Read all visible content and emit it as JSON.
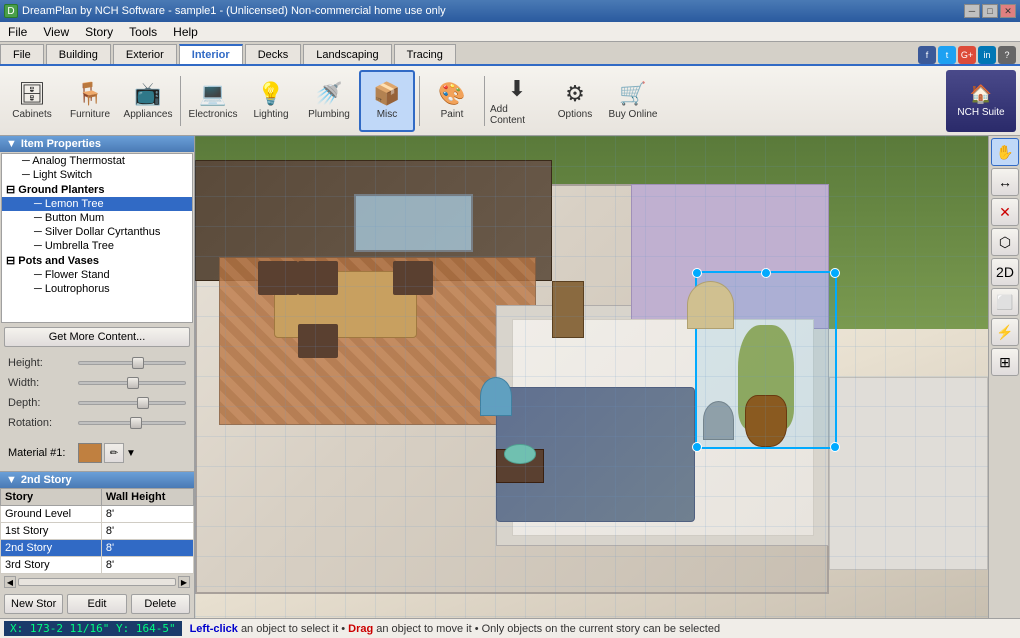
{
  "titlebar": {
    "icon": "D",
    "title": "DreamPlan by NCH Software - sample1 - (Unlicensed) Non-commercial home use only",
    "min_btn": "─",
    "max_btn": "□",
    "close_btn": "✕"
  },
  "menubar": {
    "items": [
      "File",
      "View",
      "Story",
      "Tools",
      "Help"
    ]
  },
  "tabs": {
    "items": [
      "File",
      "Building",
      "Exterior",
      "Interior",
      "Decks",
      "Landscaping",
      "Tracing"
    ],
    "active": "Interior"
  },
  "social": {
    "items": [
      "f",
      "t",
      "G+",
      "in",
      "?"
    ]
  },
  "toolbar": {
    "items": [
      {
        "label": "Cabinets",
        "icon": "🗄"
      },
      {
        "label": "Furniture",
        "icon": "🪑"
      },
      {
        "label": "Appliances",
        "icon": "📺"
      },
      {
        "label": "Electronics",
        "icon": "💻"
      },
      {
        "label": "Lighting",
        "icon": "💡"
      },
      {
        "label": "Plumbing",
        "icon": "🚿"
      },
      {
        "label": "Misc",
        "icon": "📦"
      },
      {
        "label": "Paint",
        "icon": "🎨"
      },
      {
        "label": "Add Content",
        "icon": "⬇"
      },
      {
        "label": "Options",
        "icon": "⚙"
      },
      {
        "label": "Buy Online",
        "icon": "🛒"
      }
    ],
    "active": "Misc",
    "nch": "NCH Suite"
  },
  "item_properties": {
    "header": "Item Properties",
    "tree": [
      {
        "id": "analog-thermostat",
        "label": "Analog Thermostat",
        "indent": 1
      },
      {
        "id": "light-switch",
        "label": "Light Switch",
        "indent": 1
      },
      {
        "id": "ground-planters",
        "label": "Ground Planters",
        "indent": 0,
        "category": true
      },
      {
        "id": "lemon-tree",
        "label": "Lemon Tree",
        "indent": 2
      },
      {
        "id": "button-mum",
        "label": "Button Mum",
        "indent": 2
      },
      {
        "id": "silver-dollar",
        "label": "Silver Dollar Cyrtanthus",
        "indent": 2
      },
      {
        "id": "umbrella-tree",
        "label": "Umbrella Tree",
        "indent": 2
      },
      {
        "id": "pots-vases",
        "label": "Pots and Vases",
        "indent": 0,
        "category": true
      },
      {
        "id": "flower-stand",
        "label": "Flower Stand",
        "indent": 2
      },
      {
        "id": "loutrophorus",
        "label": "Loutrophorus",
        "indent": 2
      }
    ],
    "get_more_btn": "Get More Content...",
    "props": [
      {
        "label": "Height:",
        "pos": 50
      },
      {
        "label": "Width:",
        "pos": 45
      },
      {
        "label": "Depth:",
        "pos": 55
      },
      {
        "label": "Rotation:",
        "pos": 48
      }
    ],
    "material_label": "Material #1:"
  },
  "story_section": {
    "header": "2nd Story",
    "columns": [
      "Story",
      "Wall Height"
    ],
    "rows": [
      {
        "story": "Ground Level",
        "height": "8'",
        "selected": false
      },
      {
        "story": "1st Story",
        "height": "8'",
        "selected": false
      },
      {
        "story": "2nd Story",
        "height": "8'",
        "selected": true
      },
      {
        "story": "3rd Story",
        "height": "8'",
        "selected": false
      }
    ],
    "buttons": [
      "New Stor",
      "Edit",
      "Delete"
    ]
  },
  "right_toolbar": {
    "buttons": [
      {
        "icon": "✋",
        "label": "pan-tool",
        "active": true
      },
      {
        "icon": "↔",
        "label": "rotate-tool"
      },
      {
        "icon": "✕",
        "label": "delete-tool",
        "red": true
      },
      {
        "icon": "⬡",
        "label": "terrain-tool"
      },
      {
        "icon": "2D",
        "label": "2d-tool"
      },
      {
        "icon": "⬜",
        "label": "room-tool"
      },
      {
        "icon": "⚡",
        "label": "electric-tool"
      },
      {
        "icon": "⊞",
        "label": "grid-tool"
      }
    ]
  },
  "statusbar": {
    "coords": "X: 173-2 11/16\"  Y: 164-5\"",
    "message_parts": [
      {
        "text": "Left-click",
        "style": "normal"
      },
      {
        "text": " an object to select it • ",
        "style": "normal"
      },
      {
        "text": "Drag",
        "style": "drag"
      },
      {
        "text": " an object to move it • Only objects on the current story can be selected",
        "style": "normal"
      }
    ]
  }
}
